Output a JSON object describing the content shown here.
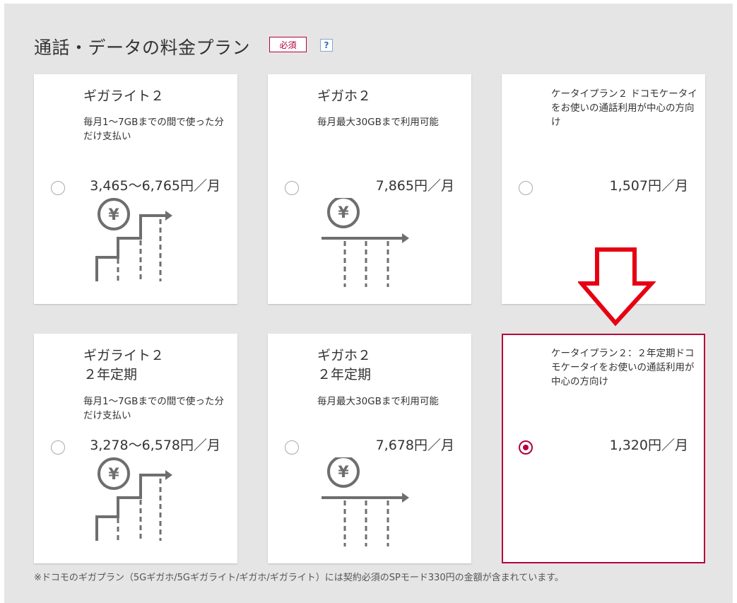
{
  "header": {
    "title": "通話・データの料金プラン",
    "required_badge": "必須",
    "help_label": "?"
  },
  "plans": [
    {
      "name": "ギガライト２",
      "desc": "毎月1〜7GBまでの間で使った分だけ支払い",
      "price": "3,465〜6,765円／月",
      "icon": "stepped-usage-yen-icon",
      "selected": false
    },
    {
      "name": "ギガホ２",
      "desc": "毎月最大30GBまで利用可能",
      "price": "7,865円／月",
      "icon": "flat-usage-yen-icon",
      "selected": false
    },
    {
      "name": "",
      "desc": "ケータイプラン２ ドコモケータイをお使いの通話利用が中心の方向け",
      "price": "1,507円／月",
      "icon": "",
      "selected": false
    },
    {
      "name": "ギガライト２\n２年定期",
      "desc": "毎月1〜7GBまでの間で使った分だけ支払い",
      "price": "3,278〜6,578円／月",
      "icon": "stepped-usage-yen-icon",
      "selected": false
    },
    {
      "name": "ギガホ２\n２年定期",
      "desc": "毎月最大30GBまで利用可能",
      "price": "7,678円／月",
      "icon": "flat-usage-yen-icon",
      "selected": false
    },
    {
      "name": "",
      "desc": "ケータイプラン２：２年定期ドコモケータイをお使いの通話利用が中心の方向け",
      "price": "1,320円／月",
      "icon": "",
      "selected": true
    }
  ],
  "annotation": {
    "icon": "red-down-arrow-icon",
    "color": "#e60012"
  },
  "footnote": "※ドコモのギガプラン（5Gギガホ/5Gギガライト/ギガホ/ギガライト）には契約必須のSPモード330円の金額が含まれています。",
  "colors": {
    "accent": "#b5003a",
    "background": "#e5e5e5",
    "card": "#ffffff",
    "illustration": "#6e6e6e"
  }
}
